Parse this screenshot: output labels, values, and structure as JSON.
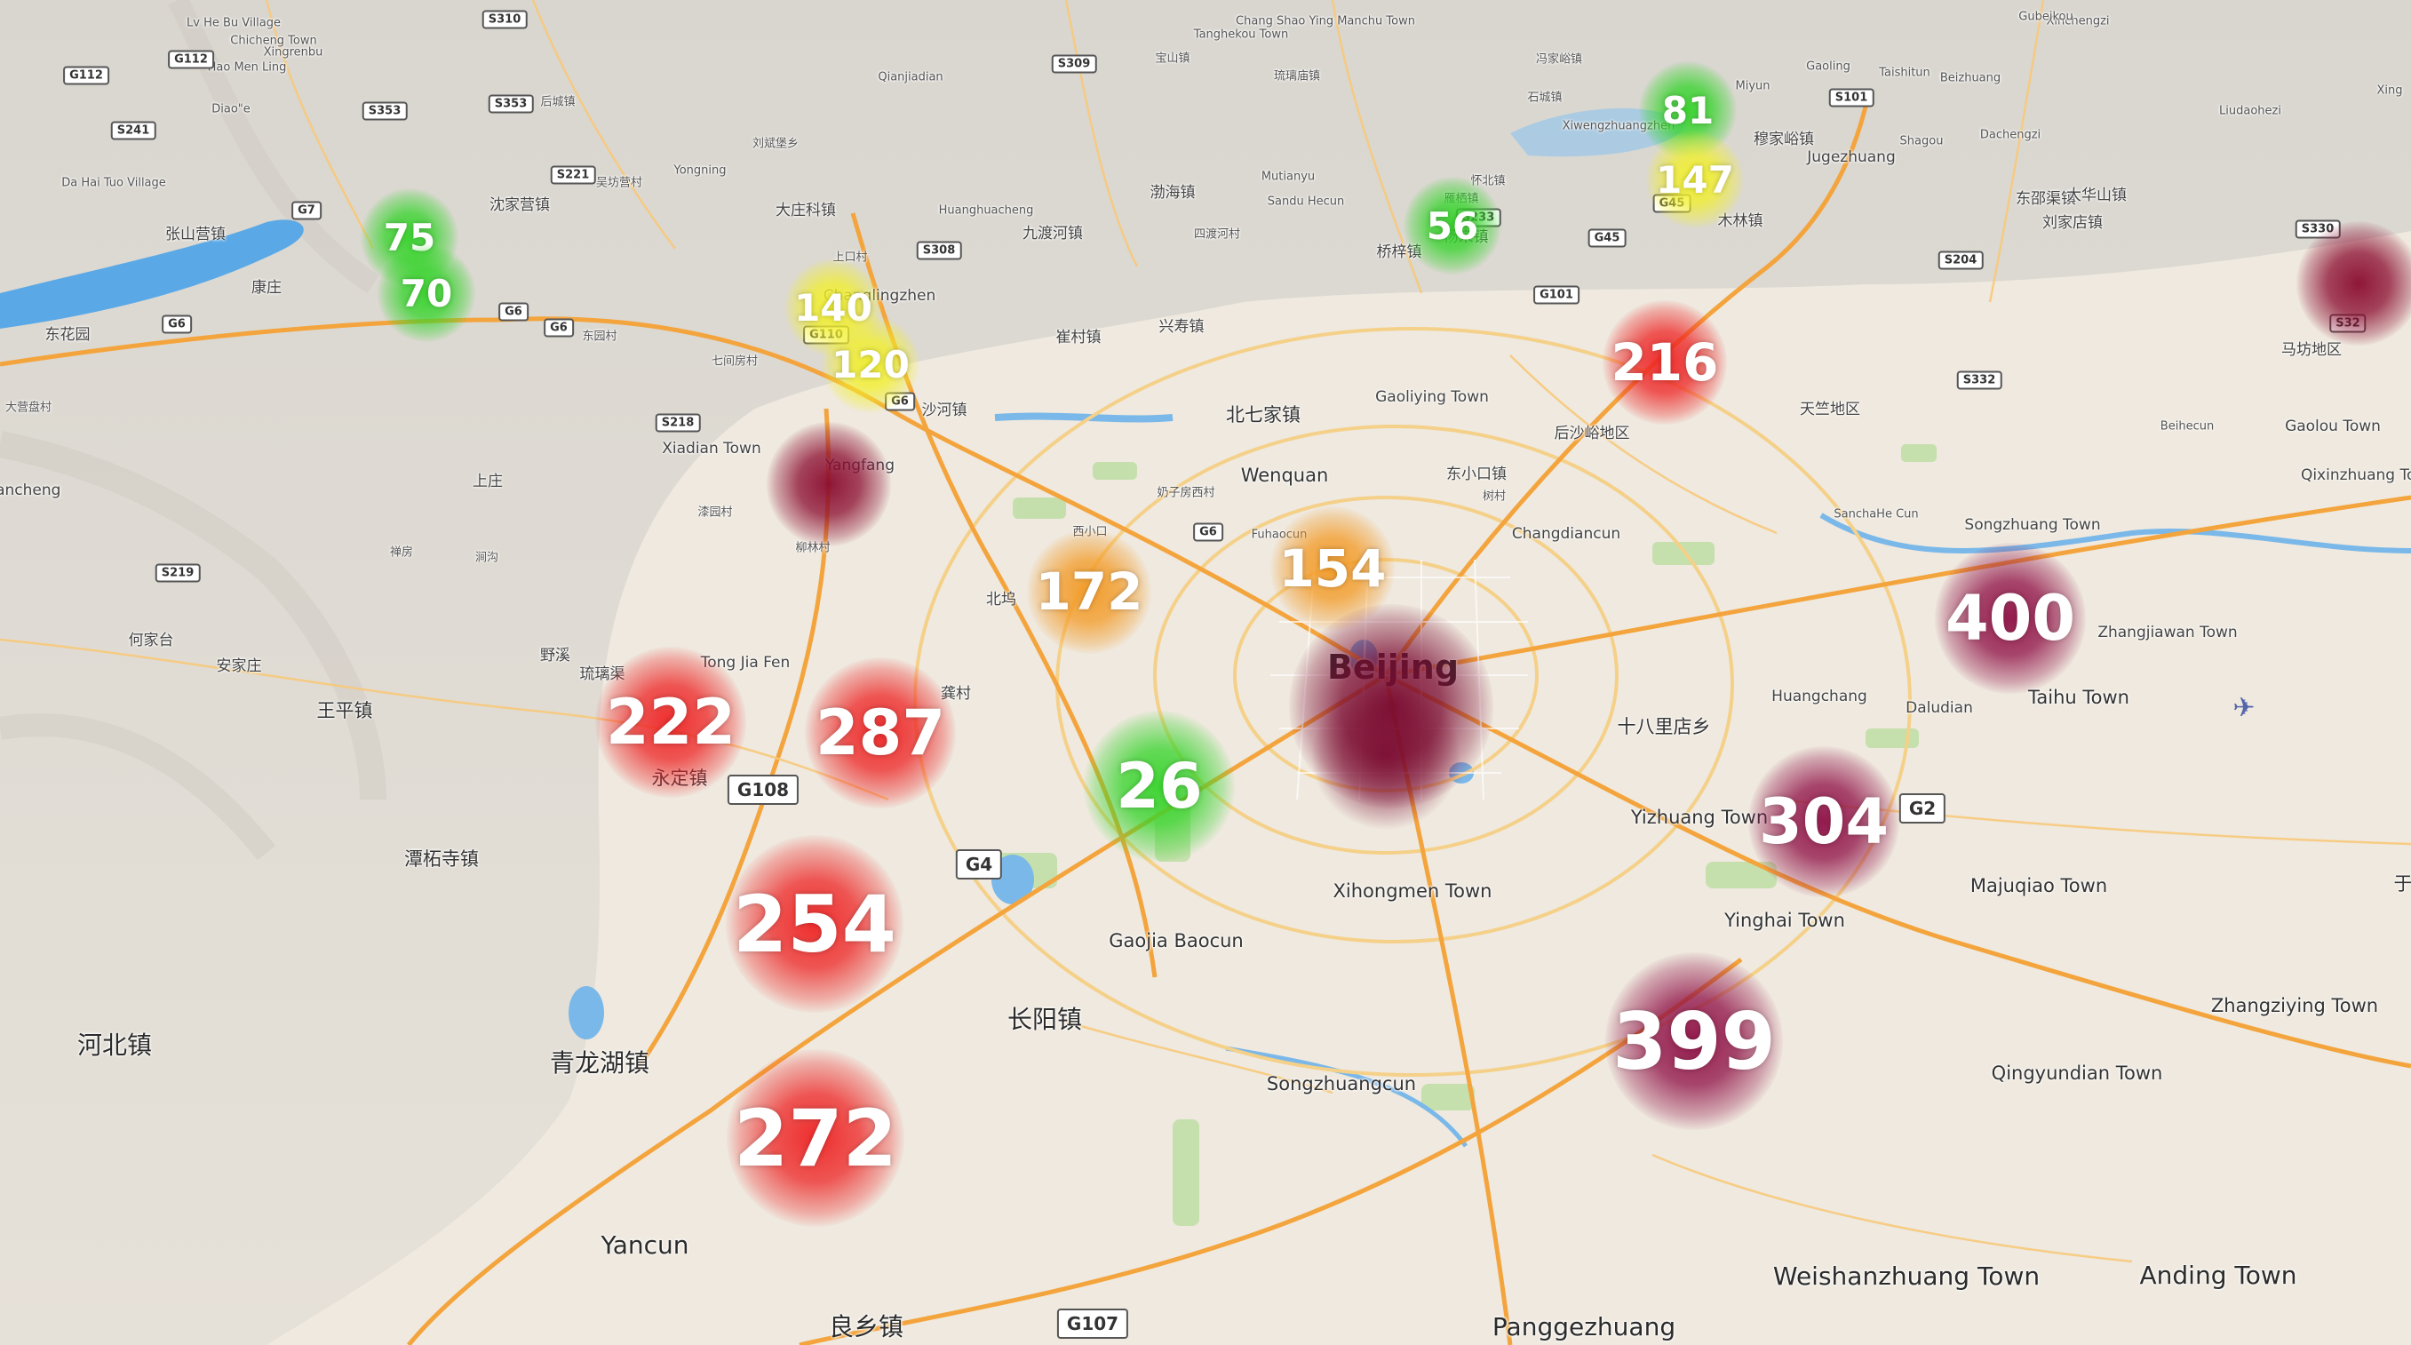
{
  "clusters": [
    {
      "id": "c75",
      "value": "75",
      "color": "#35d42a",
      "size": "s"
    },
    {
      "id": "c70",
      "value": "70",
      "color": "#35d42a",
      "size": "s"
    },
    {
      "id": "c140",
      "value": "140",
      "color": "#f2f02a",
      "size": "s"
    },
    {
      "id": "c120",
      "value": "120",
      "color": "#f2f02a",
      "size": "s"
    },
    {
      "id": "c81",
      "value": "81",
      "color": "#35d42a",
      "size": "s"
    },
    {
      "id": "c147",
      "value": "147",
      "color": "#f2f02a",
      "size": "s"
    },
    {
      "id": "c56",
      "value": "56",
      "color": "#35d42a",
      "size": "s"
    },
    {
      "id": "c216",
      "value": "216",
      "color": "#ee2424",
      "size": "m"
    },
    {
      "id": "cdark1",
      "value": "",
      "color": "#8a0b2e",
      "size": "m"
    },
    {
      "id": "cdark2",
      "value": "",
      "color": "#8a0b2e",
      "size": "m"
    },
    {
      "id": "c172",
      "value": "172",
      "color": "#f39a25",
      "size": "m"
    },
    {
      "id": "c154",
      "value": "154",
      "color": "#f39a25",
      "size": "m"
    },
    {
      "id": "c400",
      "value": "400",
      "color": "#8f0f45",
      "size": "l"
    },
    {
      "id": "c222",
      "value": "222",
      "color": "#ee2424",
      "size": "l"
    },
    {
      "id": "c287",
      "value": "287",
      "color": "#ee2424",
      "size": "l"
    },
    {
      "id": "cbeijing",
      "value": "",
      "color": "#7a0a30",
      "size": "xl"
    },
    {
      "id": "c26",
      "value": "26",
      "color": "#35d42a",
      "size": "l"
    },
    {
      "id": "c304",
      "value": "304",
      "color": "#8f0f45",
      "size": "l"
    },
    {
      "id": "c254",
      "value": "254",
      "color": "#ee2424",
      "size": "xl"
    },
    {
      "id": "c399",
      "value": "399",
      "color": "#8f0f45",
      "size": "xl"
    },
    {
      "id": "c272",
      "value": "272",
      "color": "#ee2424",
      "size": "xl"
    }
  ],
  "labels": [
    {
      "text": "Lv He Bu Village",
      "s": 1
    },
    {
      "text": "Chicheng Town",
      "s": 1
    },
    {
      "text": "Xingrenbu",
      "s": 1
    },
    {
      "text": "Hao Men Ling",
      "s": 1
    },
    {
      "text": "Diao\"e",
      "s": 1
    },
    {
      "text": "后城镇",
      "s": 1
    },
    {
      "text": "Da Hai Tuo Village",
      "s": 1
    },
    {
      "text": "张山营镇",
      "s": 2
    },
    {
      "text": "沈家营镇",
      "s": 2
    },
    {
      "text": "康庄",
      "s": 2
    },
    {
      "text": "东花园",
      "s": 2
    },
    {
      "text": "东园村",
      "s": 1
    },
    {
      "text": "大营盘村",
      "s": 1
    },
    {
      "text": "biancheng",
      "s": 2
    },
    {
      "text": "Yongning",
      "s": 1
    },
    {
      "text": "吴坊营村",
      "s": 1
    },
    {
      "text": "刘斌堡乡",
      "s": 1
    },
    {
      "text": "大庄科镇",
      "s": 2
    },
    {
      "text": "Qianjiadian",
      "s": 1
    },
    {
      "text": "Huanghuacheng",
      "s": 1
    },
    {
      "text": "九渡河镇",
      "s": 2
    },
    {
      "text": "渤海镇",
      "s": 2
    },
    {
      "text": "四渡河村",
      "s": 1
    },
    {
      "text": "Tanghekou Town",
      "s": 1
    },
    {
      "text": "Chang Shao Ying Manchu Town",
      "s": 1
    },
    {
      "text": "琉璃庙镇",
      "s": 1
    },
    {
      "text": "宝山镇",
      "s": 1
    },
    {
      "text": "Mutianyu",
      "s": 1
    },
    {
      "text": "Sandu Hecun",
      "s": 1
    },
    {
      "text": "怀北镇",
      "s": 1
    },
    {
      "text": "雁栖镇",
      "s": 1
    },
    {
      "text": "桥梓镇",
      "s": 2
    },
    {
      "text": "杨宋镇",
      "s": 2
    },
    {
      "text": "石城镇",
      "s": 1
    },
    {
      "text": "冯家峪镇",
      "s": 1
    },
    {
      "text": "Xiwengzhuangzhen",
      "s": 1
    },
    {
      "text": "Miyun",
      "s": 1
    },
    {
      "text": "穆家峪镇",
      "s": 2
    },
    {
      "text": "Jugezhuang",
      "s": 2
    },
    {
      "text": "木林镇",
      "s": 2
    },
    {
      "text": "Gaoling",
      "s": 1
    },
    {
      "text": "Taishitun",
      "s": 1
    },
    {
      "text": "Beizhuang",
      "s": 1
    },
    {
      "text": "Dachengzi",
      "s": 1
    },
    {
      "text": "东邵渠镇",
      "s": 2
    },
    {
      "text": "刘家店镇",
      "s": 2
    },
    {
      "text": "大华山镇",
      "s": 2
    },
    {
      "text": "Liudaohezi",
      "s": 1
    },
    {
      "text": "Xinchengzi",
      "s": 1
    },
    {
      "text": "Gubeikou",
      "s": 1
    },
    {
      "text": "Shagou",
      "s": 1
    },
    {
      "text": "Xing",
      "s": 1
    },
    {
      "text": "马坊地区",
      "s": 2
    },
    {
      "text": "上口村",
      "s": 1
    },
    {
      "text": "Changlingzhen",
      "s": 2
    },
    {
      "text": "七间房村",
      "s": 1
    },
    {
      "text": "崔村镇",
      "s": 2
    },
    {
      "text": "兴寿镇",
      "s": 2
    },
    {
      "text": "沙河镇",
      "s": 2
    },
    {
      "text": "北七家镇",
      "s": 3
    },
    {
      "text": "Gaoliying Town",
      "s": 2
    },
    {
      "text": "后沙峪地区",
      "s": 2
    },
    {
      "text": "天竺地区",
      "s": 2
    },
    {
      "text": "Beihecun",
      "s": 1
    },
    {
      "text": "Gaolou Town",
      "s": 2
    },
    {
      "text": "Qixinzhuang Town",
      "s": 2
    },
    {
      "text": "Xiadian Town",
      "s": 2
    },
    {
      "text": "Yangfang",
      "s": 2
    },
    {
      "text": "上庄",
      "s": 2
    },
    {
      "text": "漆园村",
      "s": 1
    },
    {
      "text": "柳林村",
      "s": 1
    },
    {
      "text": "Wenquan",
      "s": 3
    },
    {
      "text": "东小口镇",
      "s": 2
    },
    {
      "text": "奶子房西村",
      "s": 1
    },
    {
      "text": "西小口",
      "s": 1
    },
    {
      "text": "树村",
      "s": 1
    },
    {
      "text": "Changdiancun",
      "s": 2
    },
    {
      "text": "Fuhaocun",
      "s": 1
    },
    {
      "text": "SanchaHe Cun",
      "s": 1
    },
    {
      "text": "Songzhuang Town",
      "s": 2
    },
    {
      "text": "禅房",
      "s": 1
    },
    {
      "text": "涧沟",
      "s": 1
    },
    {
      "text": "北坞",
      "s": 2
    },
    {
      "text": "Zhangjiawan Town",
      "s": 2
    },
    {
      "text": "何家台",
      "s": 2
    },
    {
      "text": "安家庄",
      "s": 2
    },
    {
      "text": "野溪",
      "s": 2
    },
    {
      "text": "琉璃渠",
      "s": 2
    },
    {
      "text": "Tong Jia Fen",
      "s": 2
    },
    {
      "text": "龚村",
      "s": 2
    },
    {
      "text": "Huangchang",
      "s": 2
    },
    {
      "text": "Daludian",
      "s": 2
    },
    {
      "text": "Taihu Town",
      "s": 3
    },
    {
      "text": "王平镇",
      "s": 3
    },
    {
      "text": "十八里店乡",
      "s": 3
    },
    {
      "text": "永定镇",
      "s": 3
    },
    {
      "text": "Yizhuang Town",
      "s": 3
    },
    {
      "text": "潭柘寺镇",
      "s": 3
    },
    {
      "text": "Xihongmen Town",
      "s": 3
    },
    {
      "text": "Majuqiao Town",
      "s": 3
    },
    {
      "text": "于",
      "s": 3
    },
    {
      "text": "Gaojia Baocun",
      "s": 3
    },
    {
      "text": "Yinghai Town",
      "s": 3
    },
    {
      "text": "Zhangziying Town",
      "s": 3
    },
    {
      "text": "河北镇",
      "s": 4
    },
    {
      "text": "青龙湖镇",
      "s": 4
    },
    {
      "text": "长阳镇",
      "s": 4
    },
    {
      "text": "Songzhuangcun",
      "s": 3
    },
    {
      "text": "Qingyundian Town",
      "s": 3
    },
    {
      "text": "Yancun",
      "s": 4
    },
    {
      "text": "Weishanzhuang Town",
      "s": 4
    },
    {
      "text": "Anding Town",
      "s": 4
    },
    {
      "text": "良乡镇",
      "s": 4
    },
    {
      "text": "Panggezhuang",
      "s": 4
    },
    {
      "text": "Beijing",
      "s": 6
    }
  ],
  "shields": [
    "G112",
    "G112",
    "S353",
    "S353",
    "S241",
    "S221",
    "G7",
    "G6",
    "G6",
    "G6",
    "S308",
    "S309",
    "G110",
    "G6",
    "S218",
    "S219",
    "G6",
    "G101",
    "G45",
    "G45",
    "S233",
    "S332",
    "S330",
    "S32",
    "S204",
    "G108",
    "G4",
    "G2",
    "G107",
    "S310",
    "S101"
  ],
  "icons": {
    "airport": "airplane-icon"
  },
  "colors": {
    "land": "#efe9df",
    "mountain": "#d9d4cb",
    "water": "#5aa9e6",
    "park": "#b7dc9c",
    "road_major": "#f4a43c",
    "road_minor": "#f7c97a",
    "ring_road": "#f5d088"
  }
}
